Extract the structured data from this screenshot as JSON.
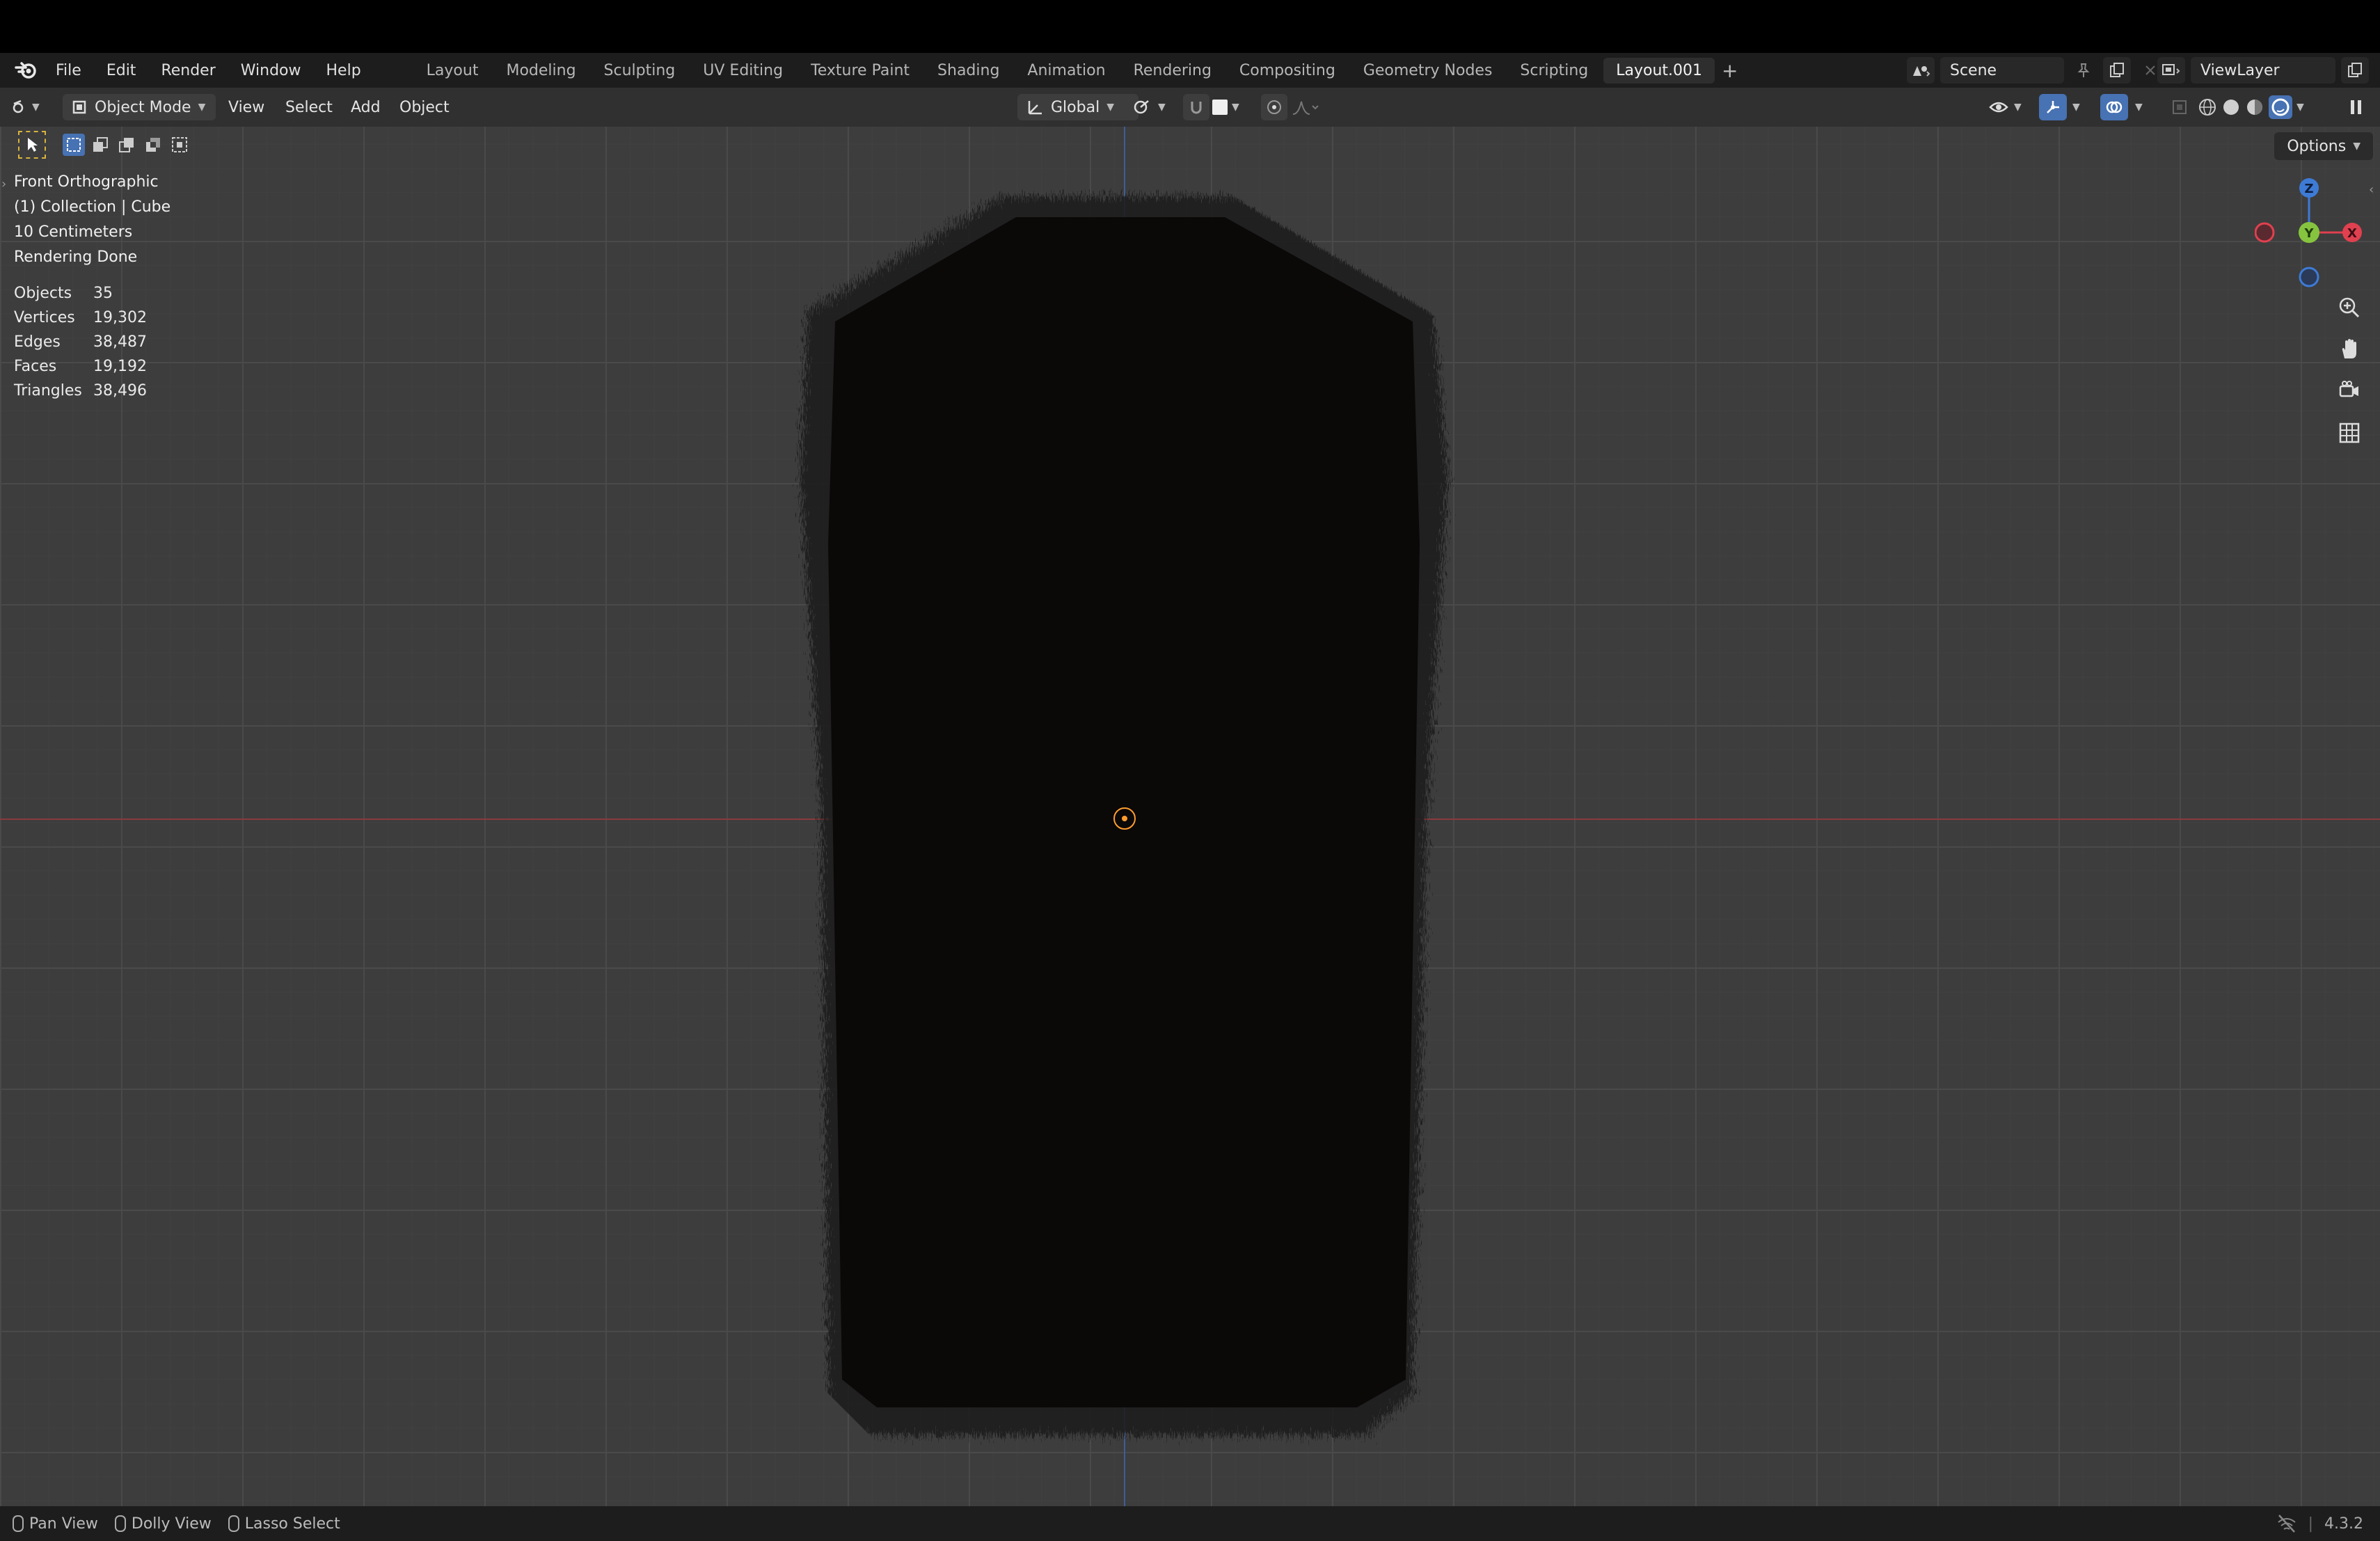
{
  "topbar": {
    "menus": [
      "File",
      "Edit",
      "Render",
      "Window",
      "Help"
    ],
    "workspaces": [
      "Layout",
      "Modeling",
      "Sculpting",
      "UV Editing",
      "Texture Paint",
      "Shading",
      "Animation",
      "Rendering",
      "Compositing",
      "Geometry Nodes",
      "Scripting",
      "Layout.001"
    ],
    "active_workspace": "Layout.001",
    "add_tab": "+",
    "scene": "Scene",
    "view_layer": "ViewLayer"
  },
  "header": {
    "mode": "Object Mode",
    "menus": [
      "View",
      "Select",
      "Add",
      "Object"
    ],
    "orientation": "Global",
    "options": "Options"
  },
  "overlay": {
    "view_name": "Front Orthographic",
    "collection": "(1) Collection | Cube",
    "scale": "10 Centimeters",
    "render_status": "Rendering Done",
    "stats": [
      {
        "label": "Objects",
        "value": "35"
      },
      {
        "label": "Vertices",
        "value": "19,302"
      },
      {
        "label": "Edges",
        "value": "38,487"
      },
      {
        "label": "Faces",
        "value": "19,192"
      },
      {
        "label": "Triangles",
        "value": "38,496"
      }
    ]
  },
  "gizmo": {
    "z": "Z",
    "y": "Y",
    "x": "X"
  },
  "statusbar": {
    "pan": "Pan View",
    "dolly": "Dolly View",
    "lasso": "Lasso Select",
    "version": "4.3.2"
  },
  "colors": {
    "x_axis": "#e0404f",
    "y_axis": "#86c43f",
    "z_axis": "#3e7bd6",
    "origin": "#ff9d2e",
    "object": "#0b0808"
  }
}
